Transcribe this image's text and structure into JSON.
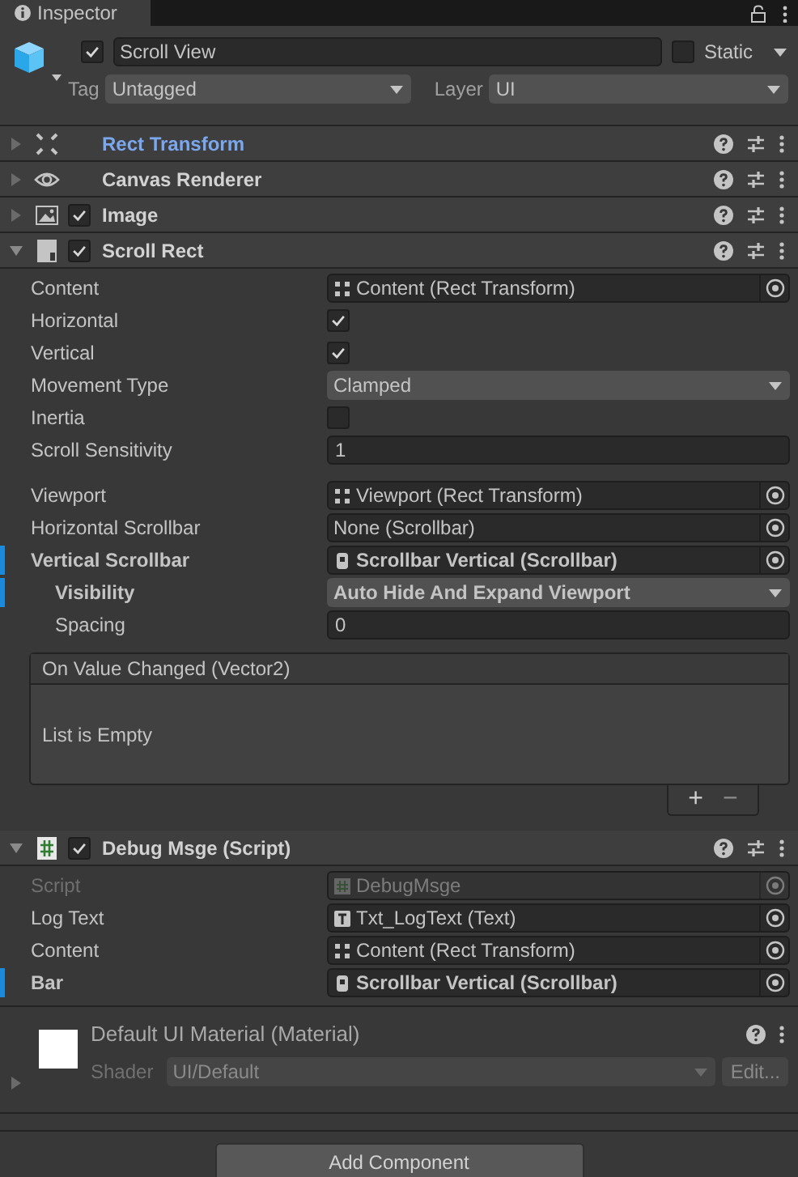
{
  "tab": {
    "title": "Inspector"
  },
  "object": {
    "active": true,
    "name": "Scroll View",
    "static": false,
    "static_label": "Static",
    "tag_label": "Tag",
    "tag": "Untagged",
    "layer_label": "Layer",
    "layer": "UI"
  },
  "components": [
    {
      "title": "Rect Transform",
      "kind": "rect",
      "highlighted": true,
      "expanded": false
    },
    {
      "title": "Canvas Renderer",
      "kind": "eye",
      "highlighted": false,
      "expanded": false
    },
    {
      "title": "Image",
      "kind": "image",
      "enabled": true,
      "highlighted": false,
      "expanded": false
    },
    {
      "title": "Scroll Rect",
      "kind": "scrollrect",
      "enabled": true,
      "highlighted": false,
      "expanded": true,
      "groups": [
        [
          {
            "label": "Content",
            "kind": "object",
            "target": {
              "kind": "rect",
              "text": "Content (Rect Transform)"
            },
            "modified": false
          },
          {
            "label": "Horizontal",
            "kind": "toggle",
            "checked": true,
            "modified": false
          },
          {
            "label": "Vertical",
            "kind": "toggle",
            "checked": true,
            "modified": false
          },
          {
            "label": "Movement Type",
            "kind": "dropdown",
            "value": "Clamped",
            "modified": false
          },
          {
            "label": "Inertia",
            "kind": "toggle",
            "checked": false,
            "modified": false
          },
          {
            "label": "Scroll Sensitivity",
            "kind": "number",
            "value": "1",
            "modified": false
          }
        ],
        [
          {
            "label": "Viewport",
            "kind": "object",
            "target": {
              "kind": "rect",
              "text": "Viewport (Rect Transform)"
            },
            "modified": false
          },
          {
            "label": "Horizontal Scrollbar",
            "kind": "object",
            "target": {
              "kind": "none",
              "text": "None (Scrollbar)"
            },
            "modified": false
          },
          {
            "label": "Vertical Scrollbar",
            "kind": "object",
            "target": {
              "kind": "scrollbar",
              "text": "Scrollbar Vertical (Scrollbar)"
            },
            "modified": true,
            "children": [
              {
                "label": "Visibility",
                "kind": "dropdown",
                "value": "Auto Hide And Expand Viewport",
                "modified": true
              },
              {
                "label": "Spacing",
                "kind": "number",
                "value": "0",
                "modified": false
              }
            ]
          }
        ]
      ],
      "event": {
        "title": "On Value Changed (Vector2)",
        "empty_text": "List is Empty",
        "add": "+",
        "remove": "−"
      }
    },
    {
      "title": "Debug Msge (Script)",
      "kind": "script",
      "enabled": true,
      "highlighted": false,
      "expanded": true,
      "groups": [
        [
          {
            "label": "Script",
            "kind": "object",
            "target": {
              "kind": "script",
              "text": "DebugMsge"
            },
            "modified": false,
            "disabled": true
          },
          {
            "label": "Log Text",
            "kind": "object",
            "target": {
              "kind": "text",
              "text": "Txt_LogText (Text)"
            },
            "modified": false
          },
          {
            "label": "Content",
            "kind": "object",
            "target": {
              "kind": "rect",
              "text": "Content (Rect Transform)"
            },
            "modified": false
          },
          {
            "label": "Bar",
            "kind": "object",
            "target": {
              "kind": "scrollbar",
              "text": "Scrollbar Vertical (Scrollbar)"
            },
            "modified": true
          }
        ]
      ]
    }
  ],
  "material": {
    "title": "Default UI Material (Material)",
    "shader_label": "Shader",
    "shader": "UI/Default",
    "edit": "Edit..."
  },
  "add_component": "Add Component"
}
